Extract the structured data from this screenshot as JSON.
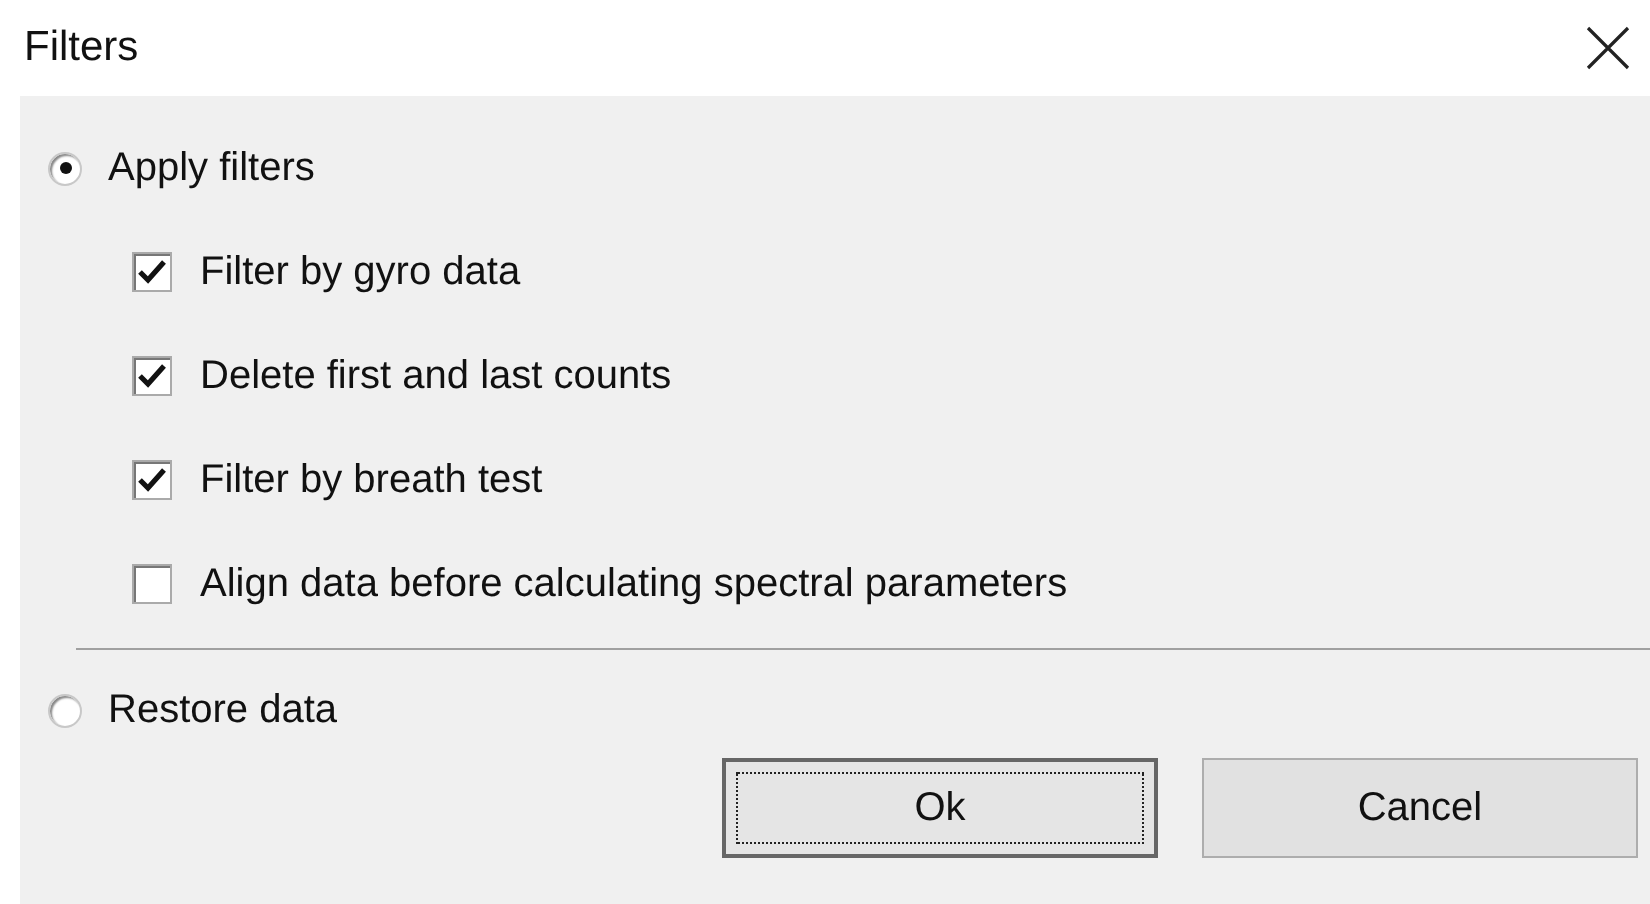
{
  "window": {
    "title": "Filters"
  },
  "options": [
    {
      "label": "Apply filters",
      "selected": true,
      "filters": [
        {
          "label": "Filter by gyro data",
          "checked": true
        },
        {
          "label": "Delete first and last counts",
          "checked": true
        },
        {
          "label": "Filter by breath test",
          "checked": true
        },
        {
          "label": "Align data before calculating spectral parameters",
          "checked": false
        }
      ]
    },
    {
      "label": "Restore data",
      "selected": false
    }
  ],
  "buttons": [
    {
      "label": "Ok",
      "focused": true
    },
    {
      "label": "Cancel",
      "focused": false
    }
  ]
}
